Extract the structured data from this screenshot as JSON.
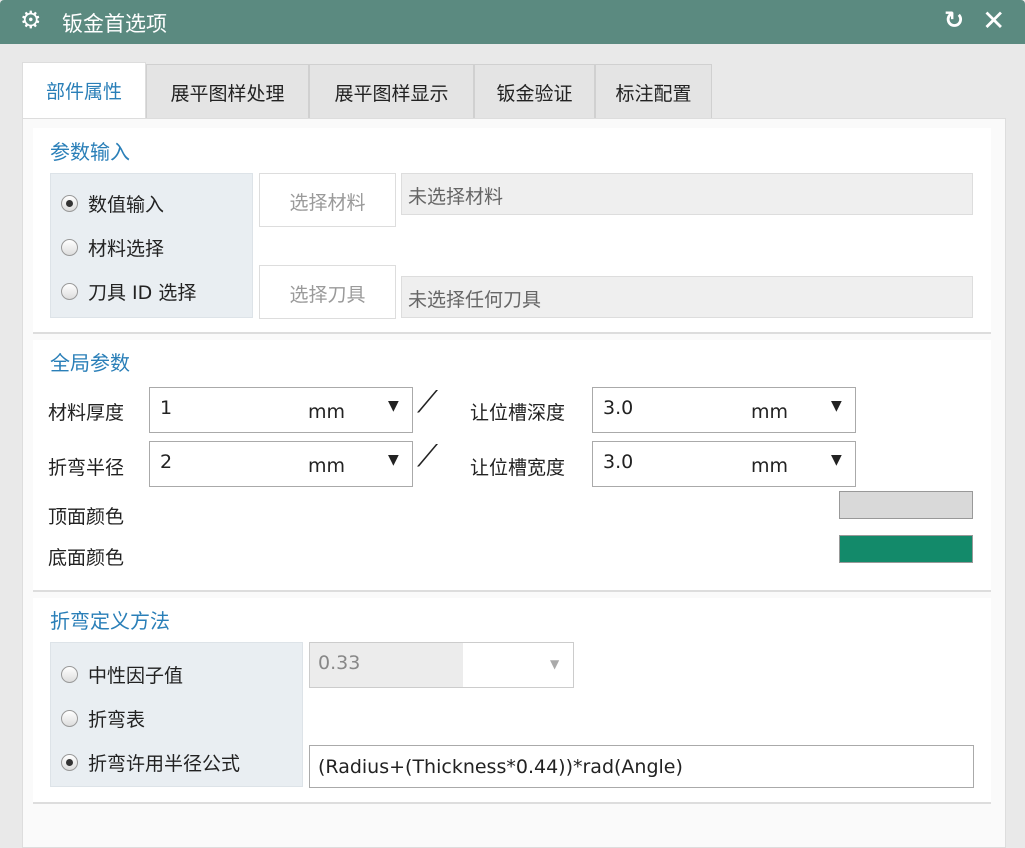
{
  "window": {
    "title": "钣金首选项",
    "icons": [
      "gear-icon",
      "reset-icon",
      "close-icon"
    ]
  },
  "tabs": [
    "部件属性",
    "展平图样处理",
    "展平图样显示",
    "钣金验证",
    "标注配置"
  ],
  "param_input": {
    "title": "参数输入",
    "radios": [
      "数值输入",
      "材料选择",
      "刀具 ID 选择"
    ],
    "selected": 0,
    "select_material_btn": "选择材料",
    "material_value": "未选择材料",
    "select_tool_btn": "选择刀具",
    "tool_value": "未选择任何刀具"
  },
  "global_params": {
    "title": "全局参数",
    "thickness": {
      "label": "材料厚度",
      "value": "1",
      "unit": "mm"
    },
    "bend_radius": {
      "label": "折弯半径",
      "value": "2",
      "unit": "mm"
    },
    "relief_depth": {
      "label": "让位槽深度",
      "value": "3.0",
      "unit": "mm"
    },
    "relief_width": {
      "label": "让位槽宽度",
      "value": "3.0",
      "unit": "mm"
    },
    "top_color": {
      "label": "顶面颜色",
      "color": "#d9d9d9"
    },
    "bottom_color": {
      "label": "底面颜色",
      "color": "#138a6a"
    }
  },
  "bend_method": {
    "title": "折弯定义方法",
    "radios": [
      "中性因子值",
      "折弯表",
      "折弯许用半径公式"
    ],
    "selected": 2,
    "k_factor": "0.33",
    "formula": "(Radius+(Thickness*0.44))*rad(Angle)"
  }
}
